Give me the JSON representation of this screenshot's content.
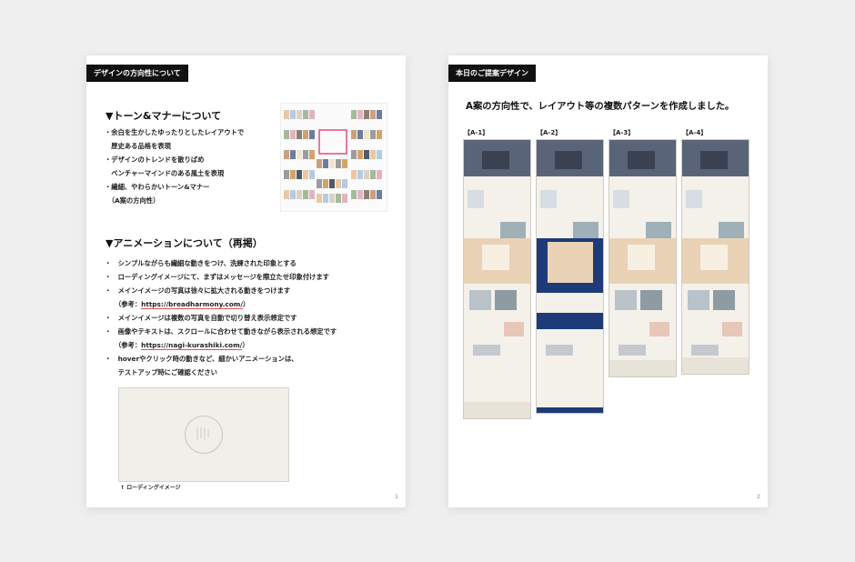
{
  "page1": {
    "tag": "デザインの方向性について",
    "tone_heading": "▼トーン&マナーについて",
    "tone_lines": [
      "・余白を生かしたゆったりとしたレイアウトで",
      "　歴史ある品格を表現",
      "・デザインのトレンドを散りばめ",
      "　ベンチャーマインドのある風土を表現",
      "・繊細、やわらかいトーン&マナー",
      "　（A案の方向性）"
    ],
    "anim_heading": "▼アニメーションについて（再掲）",
    "anim_lines": [
      {
        "text": "・　シンプルながらも繊細な動きをつけ、洗練された印象とする"
      },
      {
        "text": "・　ローディングイメージにて、まずはメッセージを際立たせ印象付けます"
      },
      {
        "text": "・　メインイメージの写真は徐々に拡大される動きをつけます"
      },
      {
        "text": "　　（参考：",
        "link": "https://breadharmony.com/",
        "tail": "）"
      },
      {
        "text": "・　メインイメージは複数の写真を自動で切り替え表示想定です"
      },
      {
        "text": "・　画像やテキストは、スクロールに合わせて動きながら表示される想定です"
      },
      {
        "text": "　　（参考：",
        "link": "https://nagi-kurashiki.com/",
        "tail": "）"
      },
      {
        "text": "・　hoverやクリック時の動きなど、細かいアニメーションは、"
      },
      {
        "text": "　　テストアップ時にご確認ください"
      }
    ],
    "caption": "↑ ローディングイメージ",
    "page_number": "1"
  },
  "page2": {
    "tag": "本日のご提案デザイン",
    "heading": "A案の方向性で、レイアウト等の複数パターンを作成しました。",
    "columns": [
      {
        "label": "【A-1】",
        "accent": "#e9d2b6"
      },
      {
        "label": "【A-2】",
        "accent": "#1f3a78"
      },
      {
        "label": "【A-3】",
        "accent": "#e9d2b6"
      },
      {
        "label": "【A-4】",
        "accent": "#e9d2b6"
      }
    ],
    "page_number": "2"
  },
  "colors": {
    "background": "#efefef",
    "tag_bg": "#111111",
    "link_underline": "#e05050",
    "navy": "#1f3a78",
    "beige": "#f4f1ea"
  }
}
